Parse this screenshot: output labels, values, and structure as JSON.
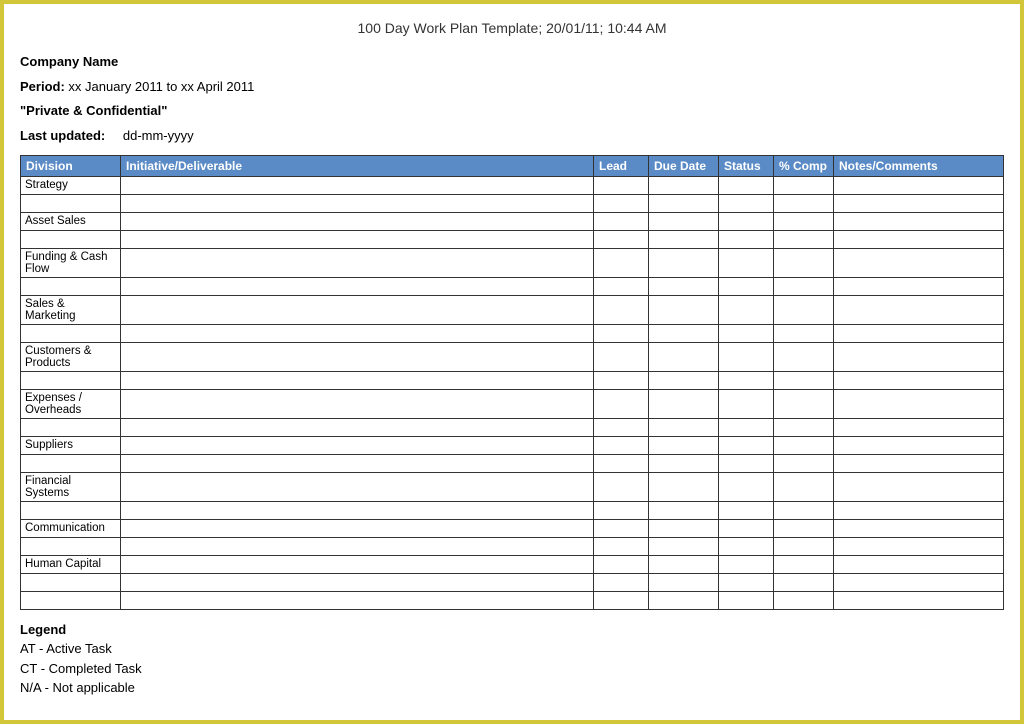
{
  "doc_title": "100 Day Work Plan Template; 20/01/11; 10:44 AM",
  "meta": {
    "company_label": "Company Name",
    "period_label": "Period:",
    "period_value": "xx January 2011 to xx April 2011",
    "confidential": "\"Private & Confidential\"",
    "last_updated_label": "Last updated:",
    "last_updated_value": "dd-mm-yyyy"
  },
  "columns": {
    "division": "Division",
    "initiative": "Initiative/Deliverable",
    "lead": "Lead",
    "due": "Due Date",
    "status": "Status",
    "comp": "% Comp",
    "notes": "Notes/Comments"
  },
  "divisions": [
    "Strategy",
    "",
    "Asset Sales",
    "",
    "Funding & Cash Flow",
    "",
    "Sales & Marketing",
    "",
    "Customers & Products",
    "",
    "Expenses / Overheads",
    "",
    "Suppliers",
    "",
    "Financial Systems",
    "",
    "Communication",
    "",
    "Human Capital",
    "",
    ""
  ],
  "legend": {
    "title": "Legend",
    "items": [
      "AT - Active Task",
      "CT - Completed Task",
      "N/A - Not applicable"
    ]
  }
}
